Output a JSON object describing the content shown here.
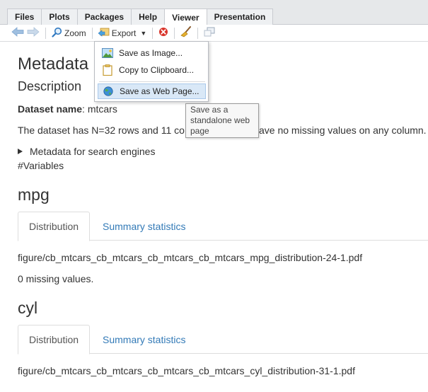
{
  "tabs": [
    "Files",
    "Plots",
    "Packages",
    "Help",
    "Viewer",
    "Presentation"
  ],
  "toolbar": {
    "zoom_label": "Zoom",
    "export_label": "Export"
  },
  "export_menu": {
    "items": [
      "Save as Image...",
      "Copy to Clipboard...",
      "Save as Web Page..."
    ]
  },
  "tooltip": {
    "lines": [
      "Save as a",
      "standalone web",
      "page"
    ]
  },
  "doc": {
    "title": "Metadata",
    "section": "Description",
    "dataset_label": "Dataset name",
    "dataset_value": ": mtcars",
    "rows_text_start": "The dataset has N=32 rows and 11 co",
    "rows_text_end": "ave no missing values on any column.",
    "details_summary": "Metadata for search engines",
    "variables_heading": "#Variables",
    "var1": {
      "name": "mpg",
      "tab_distribution": "Distribution",
      "tab_summary": "Summary statistics",
      "figure_path": "figure/cb_mtcars_cb_mtcars_cb_mtcars_cb_mtcars_mpg_distribution-24-1.pdf",
      "missing": "0 missing values."
    },
    "var2": {
      "name": "cyl",
      "tab_distribution": "Distribution",
      "tab_summary": "Summary statistics",
      "figure_path": "figure/cb_mtcars_cb_mtcars_cb_mtcars_cb_mtcars_cyl_distribution-31-1.pdf"
    }
  },
  "colors": {
    "link": "#337ab7",
    "menu_highlight": "#d9e8f7"
  }
}
